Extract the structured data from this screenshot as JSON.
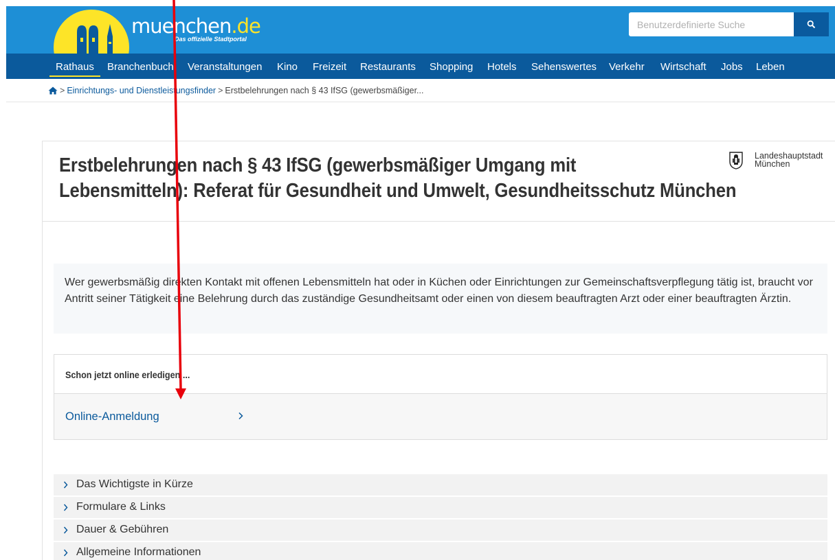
{
  "header": {
    "logo_text_main": "muenchen",
    "logo_text_tld": ".de",
    "logo_subtitle": "Das offizielle Stadtportal",
    "search_placeholder": "Benutzerdefinierte Suche",
    "colors": {
      "header_blue": "#1e8fd6",
      "nav_blue": "#0b5a9c",
      "sun_yellow": "#fde428"
    }
  },
  "nav": {
    "items": [
      {
        "label": "Rathaus",
        "active": true
      },
      {
        "label": "Branchenbuch"
      },
      {
        "label": "Veranstaltungen"
      },
      {
        "label": "Kino"
      },
      {
        "label": "Freizeit"
      },
      {
        "label": "Restaurants"
      },
      {
        "label": "Shopping"
      },
      {
        "label": "Hotels"
      },
      {
        "label": "Sehenswertes"
      },
      {
        "label": "Verkehr"
      },
      {
        "label": "Wirtschaft"
      },
      {
        "label": "Jobs"
      },
      {
        "label": "Leben"
      }
    ]
  },
  "breadcrumb": {
    "home_icon": "home-icon",
    "link": "Einrichtungs- und Dienstleistungsfinder",
    "current": "Erstbelehrungen nach § 43 IfSG (gewerbsmäßiger..."
  },
  "page": {
    "title_line1": "Erstbelehrungen nach § 43 IfSG (gewerbsmäßiger Umgang mit",
    "title_line2": "Lebensmitteln): Referat für Gesundheit und Umwelt, Gesundheitsschutz München",
    "city_label_line1": "Landeshauptstadt",
    "city_label_line2": "München",
    "intro_text": "Wer gewerbsmäßig direkten Kontakt mit offenen Lebensmitteln hat oder in Küchen oder Einrichtungen zur Gemeinschaftsverpflegung tätig ist, braucht vor Antritt seiner Tätigkeit eine Belehrung durch das zuständige Gesundheitsamt oder einen von diesem beauftragten Arzt oder einer beauftragten Ärztin."
  },
  "online": {
    "heading": "Schon jetzt online erledigen ...",
    "link_label": "Online-Anmeldung"
  },
  "accordion": {
    "items": [
      {
        "label": "Das Wichtigste in Kürze"
      },
      {
        "label": "Formulare & Links"
      },
      {
        "label": "Dauer & Gebühren"
      },
      {
        "label": "Allgemeine Informationen"
      }
    ]
  },
  "annotation": {
    "arrow_color": "#e8000b"
  }
}
